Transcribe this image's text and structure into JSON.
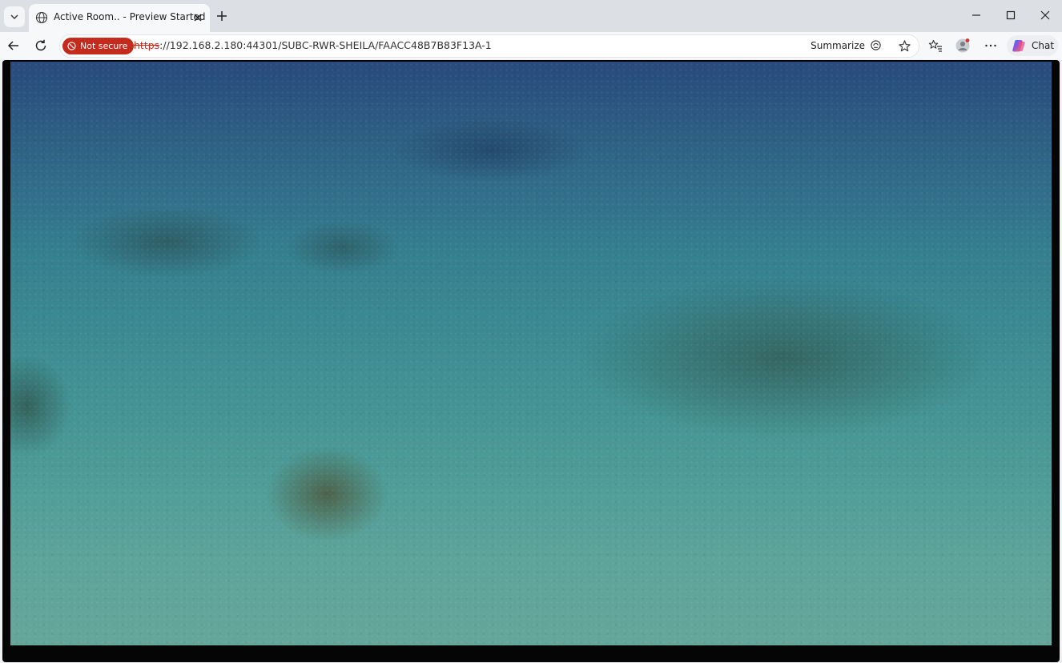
{
  "tab": {
    "title": "Active Room.. - Preview Started",
    "favicon": "globe-icon"
  },
  "omnibox": {
    "security_label": "Not secure",
    "url_scheme": "https",
    "url_rest": "://192.168.2.180:44301/SUBC-RWR-SHEILA/FAACC48B7B83F13A-1",
    "summarize_label": "Summarize"
  },
  "toolbar": {
    "chat_label": "Chat"
  },
  "colors": {
    "not_secure_red": "#c42b1c",
    "tabstrip_bg": "#dcdfe3",
    "toolbar_bg": "#f7f8f9"
  },
  "content": {
    "kind": "live underwater video feed"
  }
}
